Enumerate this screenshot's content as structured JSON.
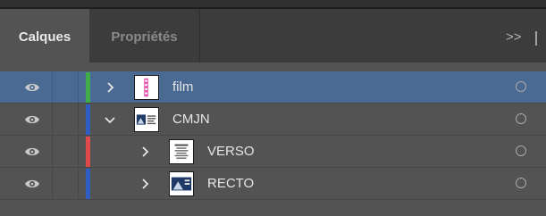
{
  "tabs": [
    {
      "label": "Calques",
      "active": true
    },
    {
      "label": "Propriétés",
      "active": false
    }
  ],
  "overflow_label": ">>",
  "layers": [
    {
      "name": "film",
      "color": "#3fae49",
      "expand": "collapsed",
      "indent": 0,
      "selected": true,
      "thumb_icon": "film-thumbnail"
    },
    {
      "name": "CMJN",
      "color": "#2f5fc4",
      "expand": "expanded",
      "indent": 0,
      "selected": false,
      "thumb_icon": "cmjn-thumbnail"
    },
    {
      "name": "VERSO",
      "color": "#e04a4a",
      "expand": "collapsed",
      "indent": 1,
      "selected": false,
      "thumb_icon": "verso-thumbnail"
    },
    {
      "name": "RECTO",
      "color": "#2f5fc4",
      "expand": "collapsed",
      "indent": 1,
      "selected": false,
      "thumb_icon": "recto-thumbnail"
    }
  ],
  "colors": {
    "panel_bg": "#535353",
    "tabbar_bg": "#3c3c3c",
    "selected_row": "#4a6a93"
  }
}
